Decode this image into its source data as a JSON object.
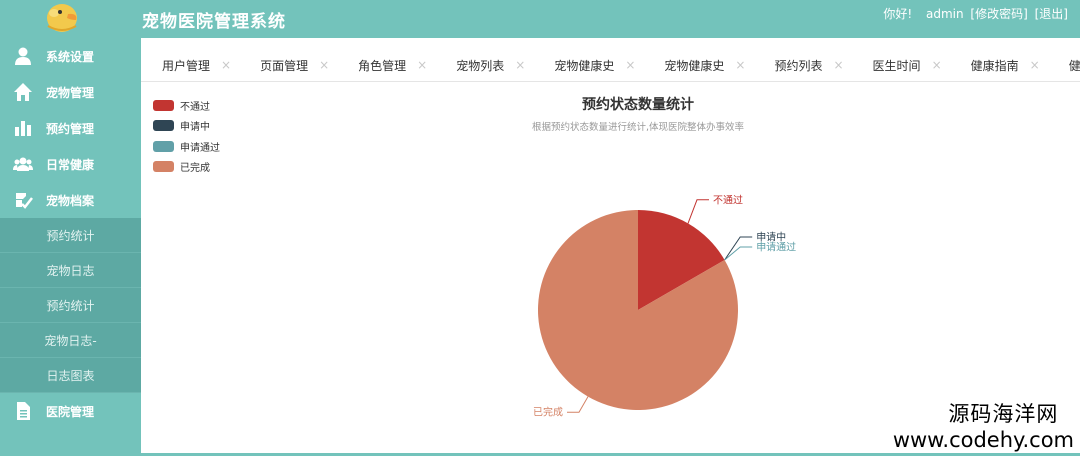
{
  "app": {
    "title": "宠物医院管理系统"
  },
  "user": {
    "greeting": "你好!",
    "name": "admin",
    "change_password": "[修改密码]",
    "logout": "[退出]"
  },
  "sidebar": {
    "items": [
      {
        "label": "系统设置",
        "icon": "user-icon"
      },
      {
        "label": "宠物管理",
        "icon": "home-icon"
      },
      {
        "label": "预约管理",
        "icon": "bar-chart-icon"
      },
      {
        "label": "日常健康",
        "icon": "group-icon"
      },
      {
        "label": "宠物档案",
        "icon": "edit-check-icon"
      }
    ],
    "sub_items": [
      {
        "label": "预约统计"
      },
      {
        "label": "宠物日志"
      },
      {
        "label": "预约统计"
      },
      {
        "label": "宠物日志-"
      },
      {
        "label": "日志图表"
      }
    ],
    "bottom_item": {
      "label": "医院管理",
      "icon": "document-icon"
    }
  },
  "tabs": [
    {
      "label": "用户管理"
    },
    {
      "label": "页面管理"
    },
    {
      "label": "角色管理"
    },
    {
      "label": "宠物列表"
    },
    {
      "label": "宠物健康史"
    },
    {
      "label": "宠物健康史"
    },
    {
      "label": "预约列表"
    },
    {
      "label": "医生时间"
    },
    {
      "label": "健康指南"
    },
    {
      "label": "健康监"
    }
  ],
  "tab_close_glyph": "×",
  "chart_data": {
    "type": "pie",
    "title": "预约状态数量统计",
    "subtitle": "根据预约状态数量进行统计,体现医院整体办事效率",
    "legend_position": "top-left",
    "series": [
      {
        "name": "不通过",
        "value": 1,
        "color": "#c23531"
      },
      {
        "name": "申请中",
        "value": 0,
        "color": "#2f4554"
      },
      {
        "name": "申请通过",
        "value": 0,
        "color": "#61a0a8"
      },
      {
        "name": "已完成",
        "value": 5,
        "color": "#d48265"
      }
    ]
  },
  "watermark": {
    "line1": "源码海洋网",
    "line2": "www.codehy.com"
  }
}
